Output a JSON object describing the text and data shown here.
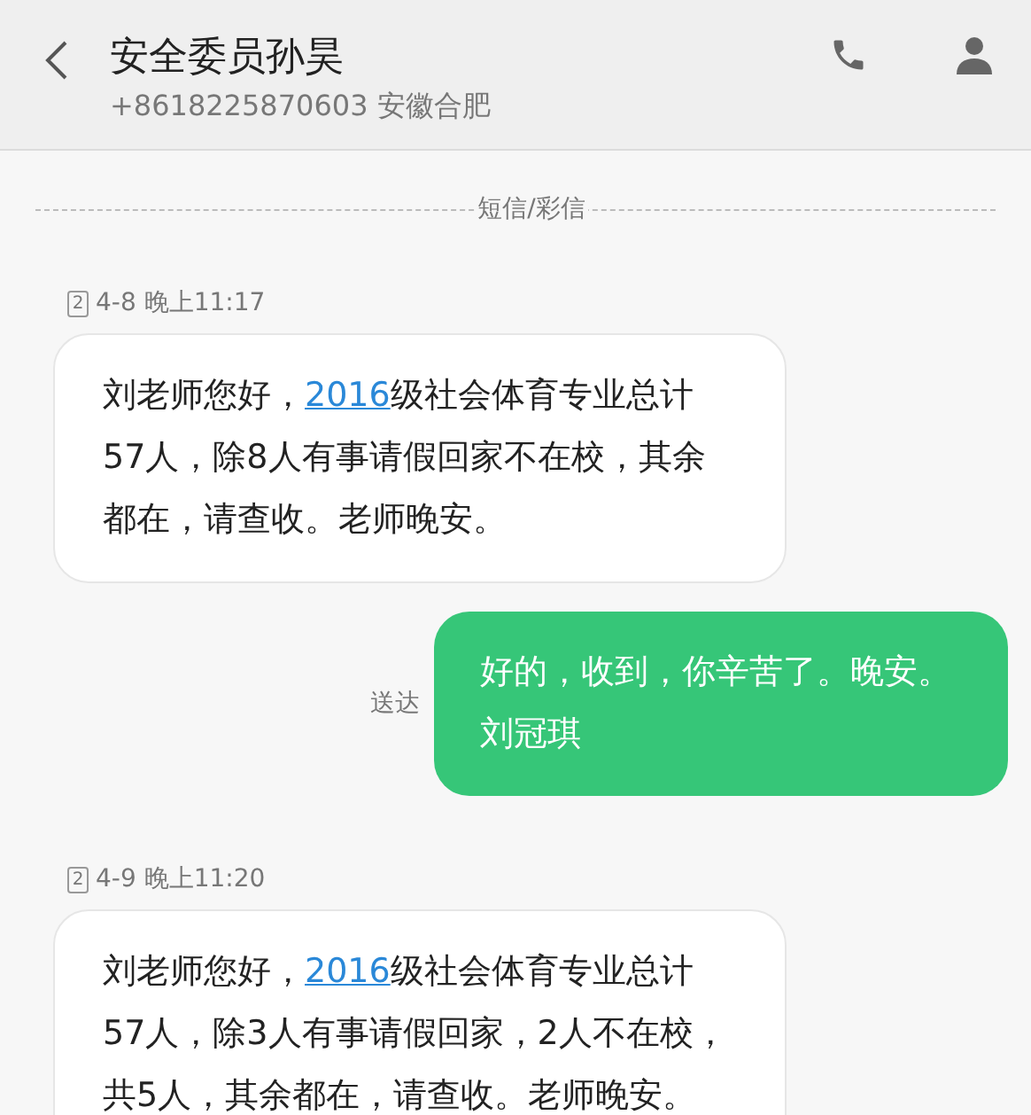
{
  "header": {
    "title": "安全委员孙昊",
    "subtitle": "+8618225870603 安徽合肥"
  },
  "divider_label": "短信/彩信",
  "messages": [
    {
      "kind": "received",
      "sim": "2",
      "time": "4-8 晚上11:17",
      "lines": [
        [
          {
            "kind": "text",
            "text": "刘老师您好，"
          },
          {
            "kind": "link",
            "text": "2016"
          },
          {
            "kind": "text",
            "text": "级社会体育专业总计"
          }
        ],
        [
          {
            "kind": "text",
            "text": "57人，除8人有事请假回家不在校，其余"
          }
        ],
        [
          {
            "kind": "text",
            "text": "都在，请查收。老师晚安。"
          }
        ]
      ]
    },
    {
      "kind": "sent",
      "status": "送达",
      "lines": [
        [
          {
            "kind": "text",
            "text": "好的，收到，你辛苦了。晚安。"
          }
        ],
        [
          {
            "kind": "text",
            "text": "刘冠琪"
          }
        ]
      ]
    },
    {
      "kind": "received",
      "sim": "2",
      "time": "4-9 晚上11:20",
      "lines": [
        [
          {
            "kind": "text",
            "text": "刘老师您好，"
          },
          {
            "kind": "link",
            "text": "2016"
          },
          {
            "kind": "text",
            "text": "级社会体育专业总计"
          }
        ],
        [
          {
            "kind": "text",
            "text": "57人，除3人有事请假回家，2人不在校，"
          }
        ],
        [
          {
            "kind": "text",
            "text": "共5人，其余都在，请查收。老师晚安。"
          }
        ]
      ]
    }
  ]
}
